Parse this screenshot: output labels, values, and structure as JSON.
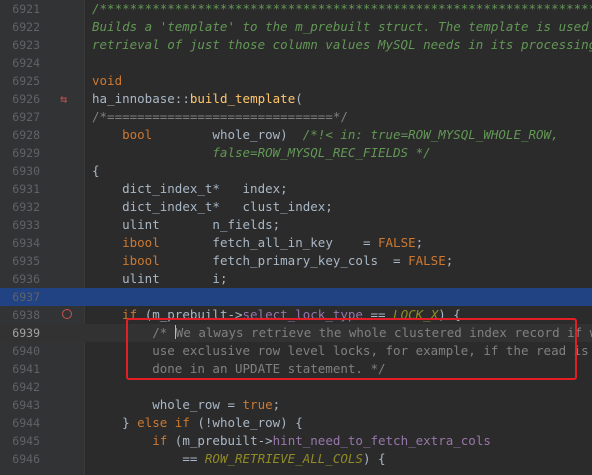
{
  "line_numbers": [
    "6921",
    "6922",
    "6923",
    "6924",
    "6925",
    "6926",
    "6927",
    "6928",
    "6929",
    "6930",
    "6931",
    "6932",
    "6933",
    "6934",
    "6935",
    "6936",
    "6937",
    "6938",
    "6939",
    "6940",
    "6941",
    "6942",
    "6943",
    "6944",
    "6945",
    "6946"
  ],
  "lines": {
    "l6921": "/*******************************************************************//**",
    "l6922": "Builds a 'template' to the m_prebuilt struct. The template is used in fast",
    "l6923": "retrieval of just those column values MySQL needs in its processing. */",
    "l6925": "void",
    "l6926_cls": "ha_innobase",
    "l6926_sep": "::",
    "l6926_fn": "build_template",
    "l6926_paren": "(",
    "l6927": "/*==============================*/",
    "l6928_type": "bool",
    "l6928_name": "        whole_row)",
    "l6928_cm": "  /*!< in: true=ROW_MYSQL_WHOLE_ROW,",
    "l6929": "                false=ROW_MYSQL_REC_FIELDS */",
    "l6930": "{",
    "l6931_type": "dict_index_t*",
    "l6931_var": "   index;",
    "l6932_type": "dict_index_t*",
    "l6932_var": "   clust_index;",
    "l6933_type": "ulint",
    "l6933_var": "       n_fields;",
    "l6934_type": "ibool",
    "l6934_var": "       fetch_all_in_key    = ",
    "l6934_val": "FALSE",
    "l6935_type": "ibool",
    "l6935_var": "       fetch_primary_key_cols  = ",
    "l6935_val": "FALSE",
    "l6936_type": "ulint",
    "l6936_var": "       i;",
    "l6938_if": "if",
    "l6938_a": " (m_prebuilt->",
    "l6938_field": "select_lock_type",
    "l6938_b": " == ",
    "l6938_mac": "LOCK_X",
    "l6938_c": ") {",
    "l6939_a": "/* ",
    "l6939_b": "We always retrieve the whole clustered index record if we",
    "l6940": "use exclusive row level locks, for example, if the read is",
    "l6941": "done in an UPDATE statement. */",
    "l6943_a": "whole_row = ",
    "l6943_val": "true",
    "l6943_b": ";",
    "l6944_a": "} ",
    "l6944_else": "else if",
    "l6944_b": " (!whole_row) {",
    "l6945_if": "if",
    "l6945_a": " (m_prebuilt->",
    "l6945_field": "hint_need_to_fetch_extra_cols",
    "l6946_a": "== ",
    "l6946_mac": "ROW_RETRIEVE_ALL_COLS",
    "l6946_b": ") {"
  },
  "colors": {
    "background": "#2b2b2b",
    "keyword": "#cc7832",
    "function": "#ffc66d",
    "comment": "#808080",
    "doc_comment": "#629755",
    "highlight_box": "#e41e26"
  }
}
